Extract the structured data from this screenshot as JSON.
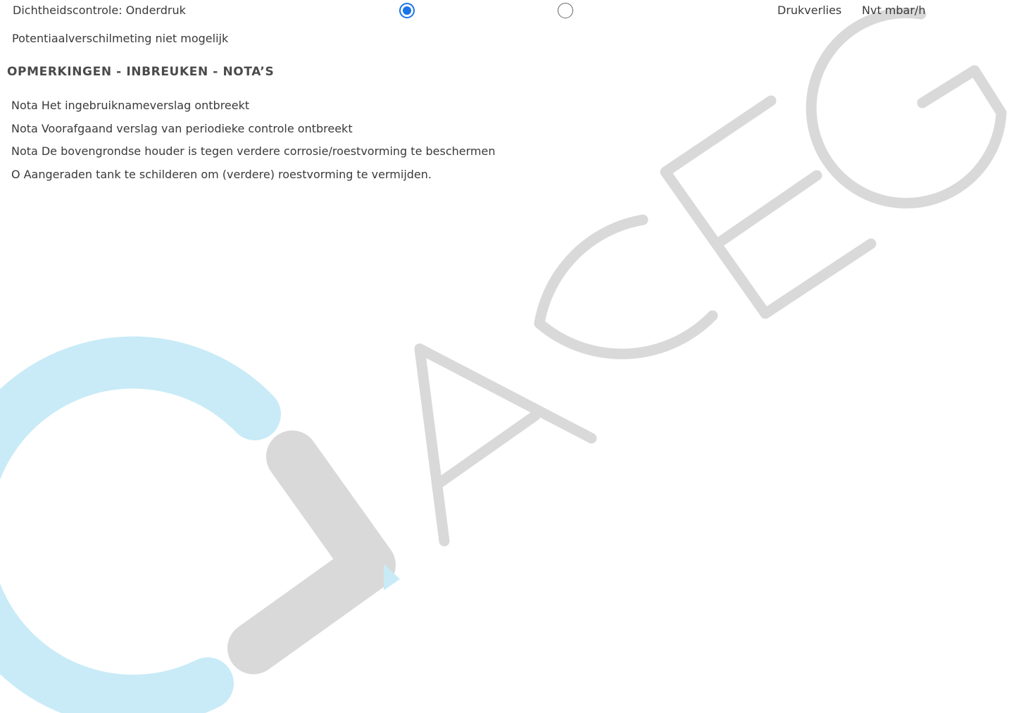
{
  "inspection": {
    "leak_test_label": "Dichtheidscontrole: Onderdruk",
    "leak_test_option_1_selected": true,
    "leak_test_option_2_selected": false,
    "pressure_loss_label": "Drukverlies",
    "pressure_loss_value": "Nvt mbar/h",
    "potential_measurement_text": "Potentiaalverschilmeting niet mogelijk"
  },
  "remarks": {
    "heading": "OPMERKINGEN - INBREUKEN - NOTA’S",
    "items": [
      {
        "type": "Nota",
        "text": "Het ingebruiknameverslag ontbreekt"
      },
      {
        "type": "Nota",
        "text": "Voorafgaand verslag van periodieke controle ontbreekt"
      },
      {
        "type": "Nota",
        "text": "De bovengrondse houder is tegen verdere corrosie/roestvorming te beschermen"
      },
      {
        "type": "O",
        "text": "Aangeraden tank te schilderen om (verdere) roestvorming te vermijden."
      }
    ]
  },
  "watermark": {
    "text": "ACEG",
    "colors": {
      "gray": "#d9d9d9",
      "cyan": "#c8ebf7"
    }
  },
  "colors": {
    "accent": "#1a73e8",
    "text": "#3a3a3a"
  }
}
